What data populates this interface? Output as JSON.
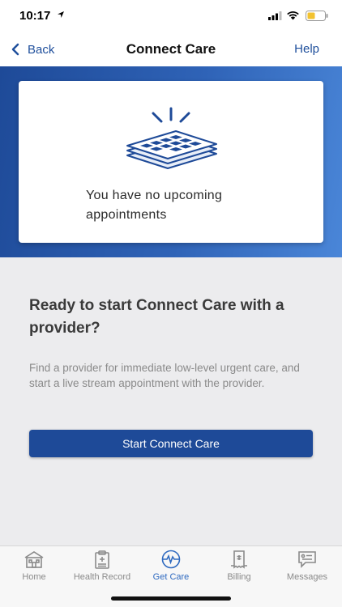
{
  "status_bar": {
    "time": "10:17"
  },
  "nav": {
    "back_label": "Back",
    "title": "Connect Care",
    "help_label": "Help"
  },
  "card": {
    "empty_message": "You have no upcoming appointments",
    "icon": "calendar-icon"
  },
  "promo": {
    "title": "Ready to start Connect Care with a provider?",
    "description": "Find a provider for immediate low-level urgent care, and start a live stream appointment with the provider.",
    "button_label": "Start Connect Care"
  },
  "tabs": [
    {
      "label": "Home",
      "icon": "home-icon",
      "active": false
    },
    {
      "label": "Health Record",
      "icon": "clipboard-icon",
      "active": false
    },
    {
      "label": "Get Care",
      "icon": "pulse-icon",
      "active": true
    },
    {
      "label": "Billing",
      "icon": "receipt-icon",
      "active": false
    },
    {
      "label": "Messages",
      "icon": "chat-icon",
      "active": false
    }
  ],
  "colors": {
    "brand_blue": "#1e4a98",
    "gradient_end": "#4a86d8",
    "link_blue": "#1f4f9c",
    "active_tab": "#2f6ac0",
    "background": "#ececee"
  }
}
